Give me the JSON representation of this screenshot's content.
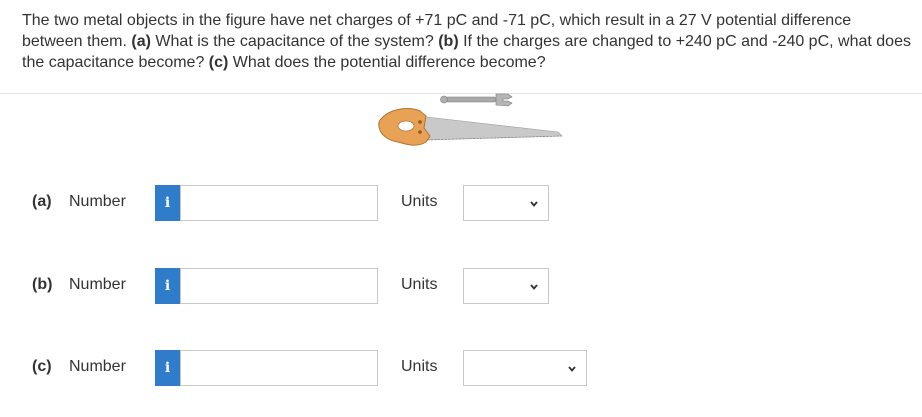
{
  "question": {
    "intro": "The two metal objects in the figure have net charges of +71 pC and -71 pC, which result in a 27 V potential difference between them. ",
    "part_a_tag": "(a)",
    "part_a_text": " What is the capacitance of the system? ",
    "part_b_tag": "(b)",
    "part_b_text": " If the charges are changed to +240 pC and -240 pC, what does the capacitance become? ",
    "part_c_tag": "(c)",
    "part_c_text": " What does the potential difference become?"
  },
  "answers": [
    {
      "part": "(a)",
      "number_label": "Number",
      "info": "i",
      "value": "",
      "units_label": "Units",
      "units_value": ""
    },
    {
      "part": "(b)",
      "number_label": "Number",
      "info": "i",
      "value": "",
      "units_label": "Units",
      "units_value": ""
    },
    {
      "part": "(c)",
      "number_label": "Number",
      "info": "i",
      "value": "",
      "units_label": "Units",
      "units_value": ""
    }
  ],
  "icons": {
    "info": "info-icon",
    "dropdown": "chevron-down-icon"
  },
  "colors": {
    "info_button": "#2f7ccb",
    "text": "#333333",
    "input_border": "#c8c8c8"
  }
}
